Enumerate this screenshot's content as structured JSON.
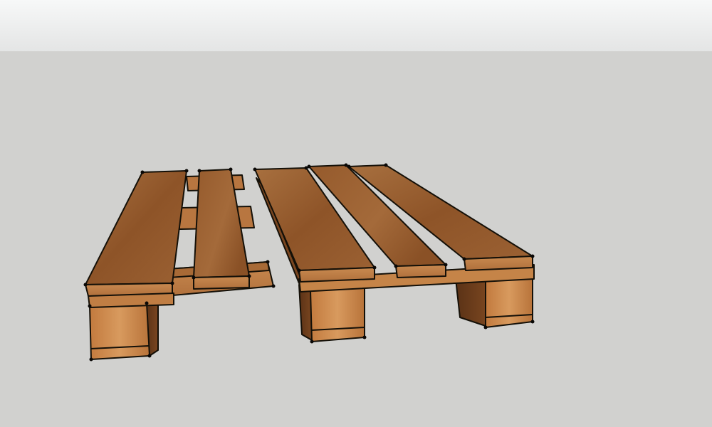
{
  "scene": {
    "background": {
      "sky_top": "#f7f8f8",
      "sky_bottom": "#e4e5e5",
      "ground": "#d1d1cf"
    },
    "materials": {
      "wood_top": "#9a5f33",
      "wood_top_light": "#b07a48",
      "wood_side": "#c9854a",
      "wood_front": "#a66a3a",
      "wood_dark": "#6e3f1d",
      "edge_line": "#141008"
    },
    "objects": [
      "pallet-left",
      "pallet-right"
    ]
  }
}
